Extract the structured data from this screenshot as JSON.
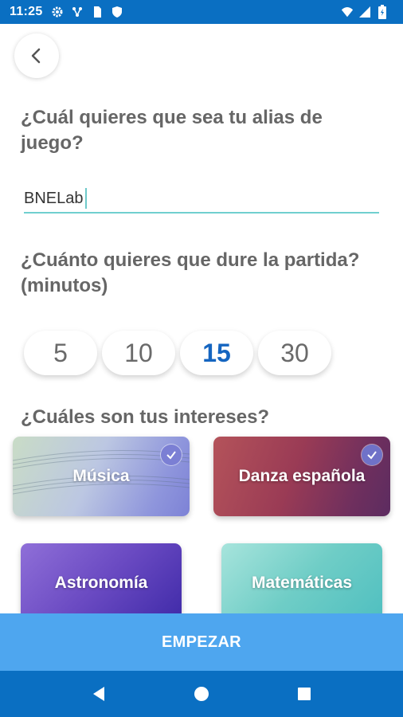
{
  "status_bar": {
    "time": "11:25",
    "left_icons": [
      "gear-icon",
      "network-icon",
      "sim-card-icon",
      "shield-icon"
    ],
    "right_icons": [
      "wifi-icon",
      "signal-icon",
      "battery-icon"
    ]
  },
  "back_button": {
    "icon": "chevron-left-icon"
  },
  "alias": {
    "question": "¿Cuál quieres que sea tu alias de juego?",
    "value": "BNELab"
  },
  "duration": {
    "question": "¿Cuánto quieres que dure la partida? (minutos)",
    "options": [
      "5",
      "10",
      "15",
      "30"
    ],
    "selected": "15"
  },
  "interests": {
    "question": "¿Cuáles son tus intereses?",
    "items": [
      {
        "label": "Música",
        "selected": true
      },
      {
        "label": "Danza española",
        "selected": true
      },
      {
        "label": "Astronomía",
        "selected": false
      },
      {
        "label": "Matemáticas",
        "selected": false
      }
    ]
  },
  "start_button": {
    "label": "EMPEZAR"
  },
  "nav_bar": {
    "icons": [
      "back-triangle-icon",
      "home-circle-icon",
      "recents-square-icon"
    ]
  },
  "colors": {
    "status_bar": "#0a6fc2",
    "accent": "#1565c0",
    "input_underline": "#70cfcf",
    "start_button": "#4ea6ef",
    "check_badge": "#7b7fd4"
  }
}
